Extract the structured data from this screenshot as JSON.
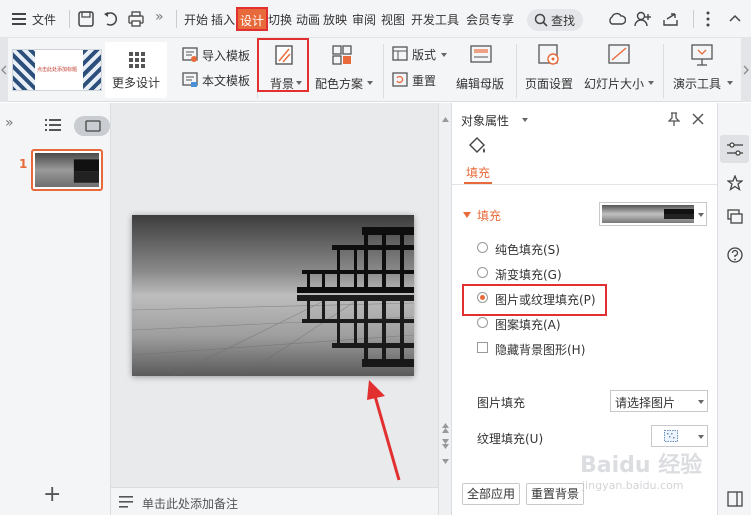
{
  "menubar": {
    "file_label": "文件",
    "more_chevrons": "»",
    "tabs": [
      "开始",
      "插入",
      "设计",
      "切换",
      "动画",
      "放映",
      "审阅",
      "视图",
      "开发工具",
      "会员专享"
    ],
    "active_tab": "设计",
    "search_label": "查找"
  },
  "ribbon": {
    "more_design": "更多设计",
    "import_template": "导入模板",
    "text_template": "本文模板",
    "background": "背景",
    "color_scheme": "配色方案",
    "layout": "版式",
    "reset": "重置",
    "edit_master": "编辑母版",
    "page_setup": "页面设置",
    "slide_size": "幻灯片大小",
    "presentation_tools": "演示工具",
    "template_thumb_text": "点击此处添加标题"
  },
  "left_panel": {
    "expand_chevrons": "»",
    "slide_number": "1",
    "add_slide": "+"
  },
  "notes": {
    "placeholder": "单击此处添加备注"
  },
  "right_panel": {
    "title": "对象属性",
    "fill_tab": "填充",
    "section_title": "填充",
    "options": [
      {
        "label": "纯色填充(S)",
        "selected": false
      },
      {
        "label": "渐变填充(G)",
        "selected": false
      },
      {
        "label": "图片或纹理填充(P)",
        "selected": true
      },
      {
        "label": "图案填充(A)",
        "selected": false
      }
    ],
    "hide_bg_graphics": "隐藏背景图形(H)",
    "picture_fill_label": "图片填充",
    "picture_fill_value": "请选择图片",
    "texture_fill_label": "纹理填充(U)",
    "apply_all": "全部应用",
    "reset_background": "重置背景"
  },
  "watermark": {
    "brand": "Baidu 经验",
    "url": "jingyan.baidu.com"
  },
  "colors": {
    "accent": "#e86a3a",
    "highlight_box": "#e23030",
    "arrow": "#e23030"
  }
}
